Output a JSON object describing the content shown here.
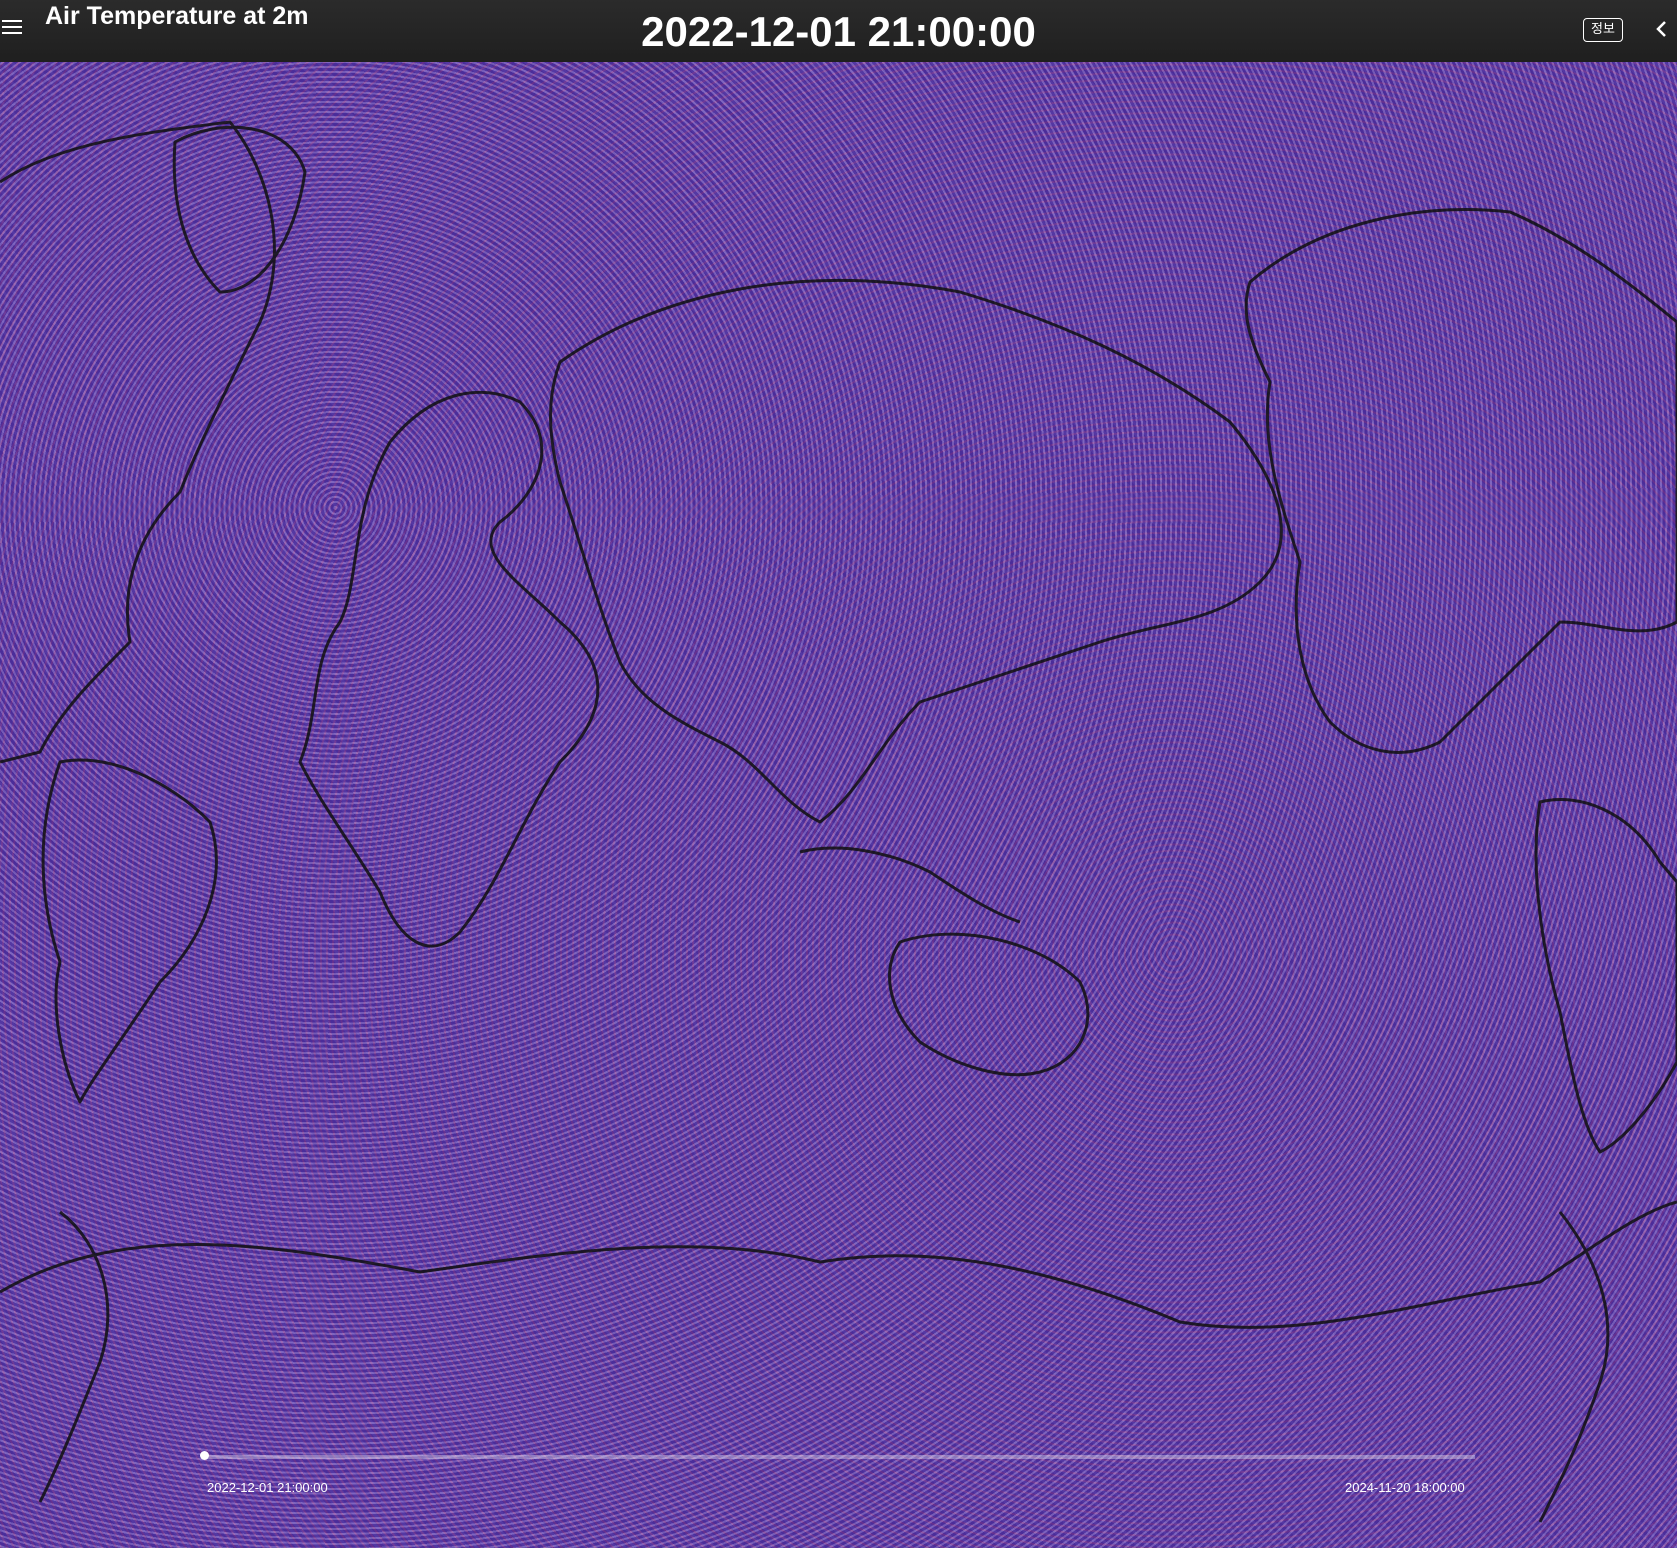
{
  "header": {
    "layer_title": "Air Temperature at 2m",
    "datetime": "2022-12-01 21:00:00",
    "info_label": "정보"
  },
  "timeline": {
    "start_label": "2022-12-01 21:00:00",
    "end_label": "2024-11-20 18:00:00",
    "position": 0.0
  },
  "colors": {
    "header_bg": "#232323",
    "map_base": "#6b3fb0",
    "cold": "#2a2ac0",
    "warm": "#e03040",
    "coastline": "#111111"
  },
  "icons": {
    "menu": "hamburger-icon",
    "collapse": "chevron-left-icon"
  }
}
